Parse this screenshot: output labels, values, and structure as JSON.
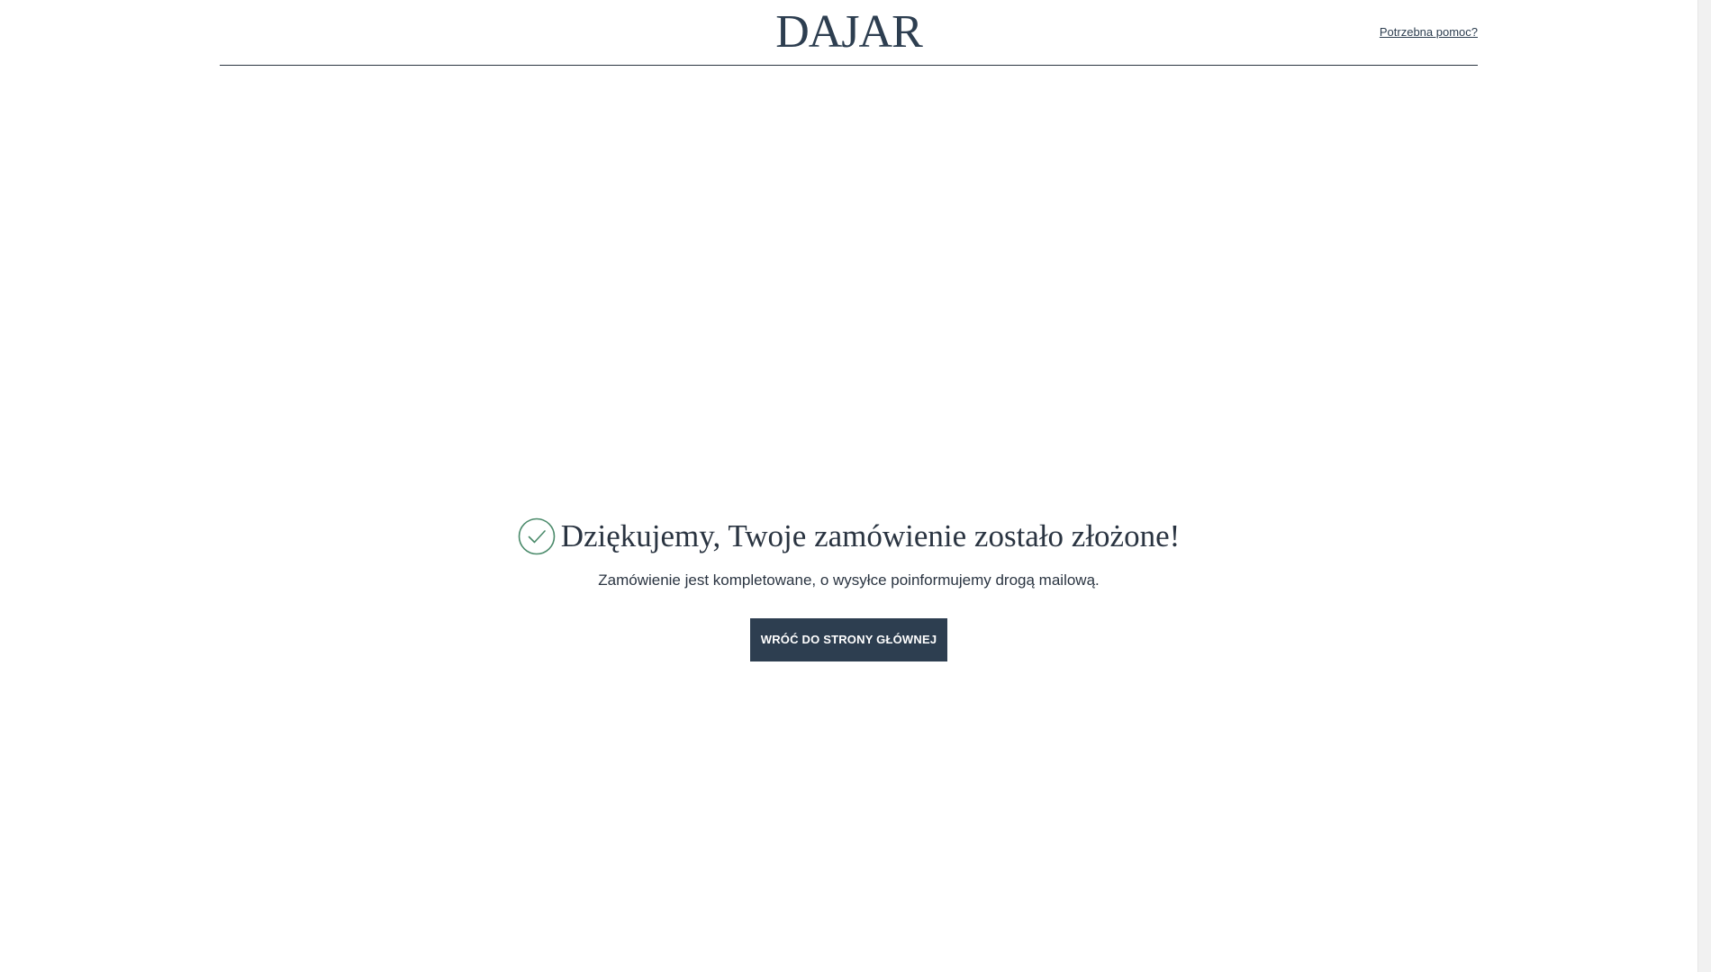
{
  "header": {
    "logo": "DAJAR",
    "help_link": "Potrzebna pomoc?"
  },
  "confirmation": {
    "icon": "check-circle-icon",
    "title": "Dziękujemy, Twoje zamówienie zostało złożone!",
    "message": "Zamówienie jest kompletowane, o wysyłce poinformujemy drogą mailową.",
    "button_label": "WRÓĆ DO STRONY GŁÓWNEJ"
  },
  "colors": {
    "brand": "#2d3e50",
    "success": "#4a8a6a",
    "background": "#ffffff"
  }
}
